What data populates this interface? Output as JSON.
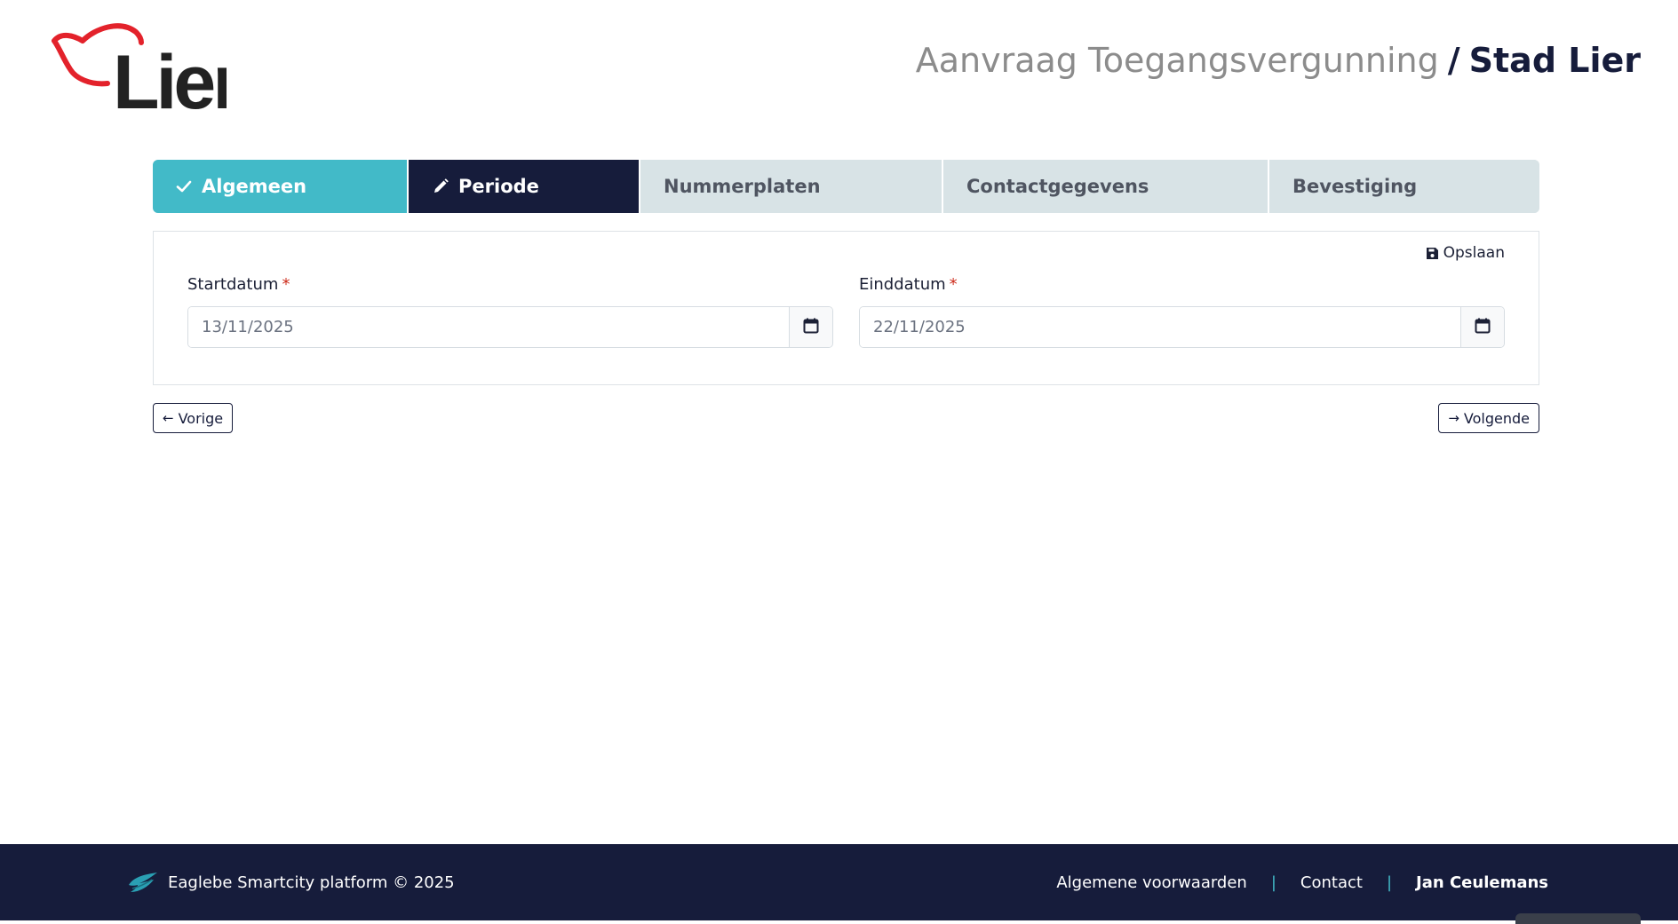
{
  "brand": {
    "logo_text": "Lier",
    "logo_color_outline": "#e3222b",
    "logo_color_text": "#222222"
  },
  "header": {
    "title": "Aanvraag Toegangsvergunning",
    "separator": "/",
    "subtitle": "Stad Lier"
  },
  "stepper": {
    "steps": [
      {
        "label": "Algemeen",
        "state": "completed",
        "icon": "check-icon"
      },
      {
        "label": "Periode",
        "state": "current",
        "icon": "pencil-icon"
      },
      {
        "label": "Nummerplaten",
        "state": "upcoming"
      },
      {
        "label": "Contactgegevens",
        "state": "upcoming"
      },
      {
        "label": "Bevestiging",
        "state": "upcoming"
      }
    ]
  },
  "form": {
    "save_label": "Opslaan",
    "start": {
      "label": "Startdatum",
      "required_mark": "*",
      "value": "13/11/2025"
    },
    "end": {
      "label": "Einddatum",
      "required_mark": "*",
      "value": "22/11/2025"
    }
  },
  "nav": {
    "prev_label": "Vorige",
    "next_label": "Volgende"
  },
  "footer": {
    "brand_text": "Eaglebe Smartcity platform © 2025",
    "links": [
      "Algemene voorwaarden",
      "Contact"
    ],
    "separator": "|",
    "user": "Jan Ceulemans"
  },
  "colors": {
    "accent": "#42bac8",
    "navy": "#161c3b",
    "step_inactive": "#d8e3e6",
    "required": "#cc2a1a"
  }
}
